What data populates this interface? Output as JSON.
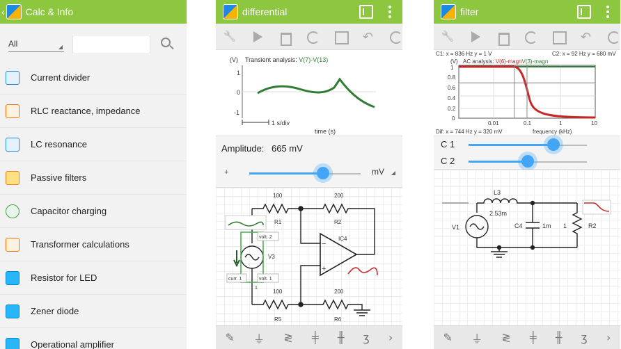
{
  "screen1": {
    "title": "Calc & Info",
    "filter_value": "All",
    "search_placeholder": "",
    "items": [
      {
        "label": "Current divider",
        "icon": "current-divider-icon"
      },
      {
        "label": "RLC reactance, impedance",
        "icon": "rlc-icon"
      },
      {
        "label": "LC resonance",
        "icon": "lc-resonance-icon"
      },
      {
        "label": "Passive filters",
        "icon": "passive-filter-icon"
      },
      {
        "label": "Capacitor charging",
        "icon": "capacitor-icon"
      },
      {
        "label": "Transformer calculations",
        "icon": "transformer-icon"
      },
      {
        "label": "Resistor for LED",
        "icon": "led-resistor-icon"
      },
      {
        "label": "Zener diode",
        "icon": "zener-icon"
      },
      {
        "label": "Operational amplifier",
        "icon": "opamp-icon"
      }
    ]
  },
  "screen2": {
    "title": "differential",
    "plot": {
      "unit": "(V)",
      "title": "Transient analysis: ",
      "series": "V(7)-V(13)",
      "y_ticks": [
        "1",
        "0",
        "-1"
      ],
      "scale_label": "1 s/div",
      "xlabel": "time (s)"
    },
    "amplitude_label": "Amplitude:",
    "amplitude_value": "665 mV",
    "slider_sign": "+",
    "slider_unit": "mV",
    "slider_fraction": 0.66,
    "circuit": {
      "r1_value": "100",
      "r1_label": "R1",
      "r2_value": "200",
      "r2_label": "R2",
      "r5_value": "100",
      "r5_label": "R5",
      "r6_value": "200",
      "r6_label": "R6",
      "opamp_label": "IC4",
      "source_label": "V3",
      "volt2": "volt. 2",
      "volt1": "volt. 1",
      "curr1": "curr. 1",
      "node_label": "1",
      "minus": "−",
      "plus": "+"
    }
  },
  "screen3": {
    "title": "filter",
    "cursor1": "C1: x = 836 Hz  y = 1 V",
    "cursor2": "C2: x = 92 Hz  y = 680 mV",
    "plot": {
      "unit": "(V)",
      "title": "AC analysis: ",
      "series1": "V(6)-magn",
      "series2": "V(3)-magn",
      "y_ticks": [
        "1",
        "0.8",
        "0.6",
        "0.4",
        "0.2",
        "0"
      ],
      "x_ticks": [
        "0.01",
        "0.1",
        "1",
        "10"
      ],
      "xlabel": "frequency (kHz)"
    },
    "diff": "Dif: x = 744 Hz  y = 320 mV",
    "c1_label": "C 1",
    "c2_label": "C 2",
    "c1_fraction": 0.72,
    "c2_fraction": 0.5,
    "circuit": {
      "l_label": "L3",
      "l_value": "2.53m",
      "c_label": "C4",
      "c_value": "1m",
      "r_label": "R2",
      "r_value": "1",
      "v_label": "V1"
    }
  },
  "bottom_tools": [
    "pencil-icon",
    "ground-icon",
    "resistor-icon",
    "capacitor-icon",
    "polarized-cap-icon",
    "inductor-icon",
    "more-icon"
  ],
  "colors": {
    "appbar": "#8dc63f",
    "accent": "#42a5f5",
    "trace_green": "#2e7d32",
    "trace_red": "#c62828"
  }
}
